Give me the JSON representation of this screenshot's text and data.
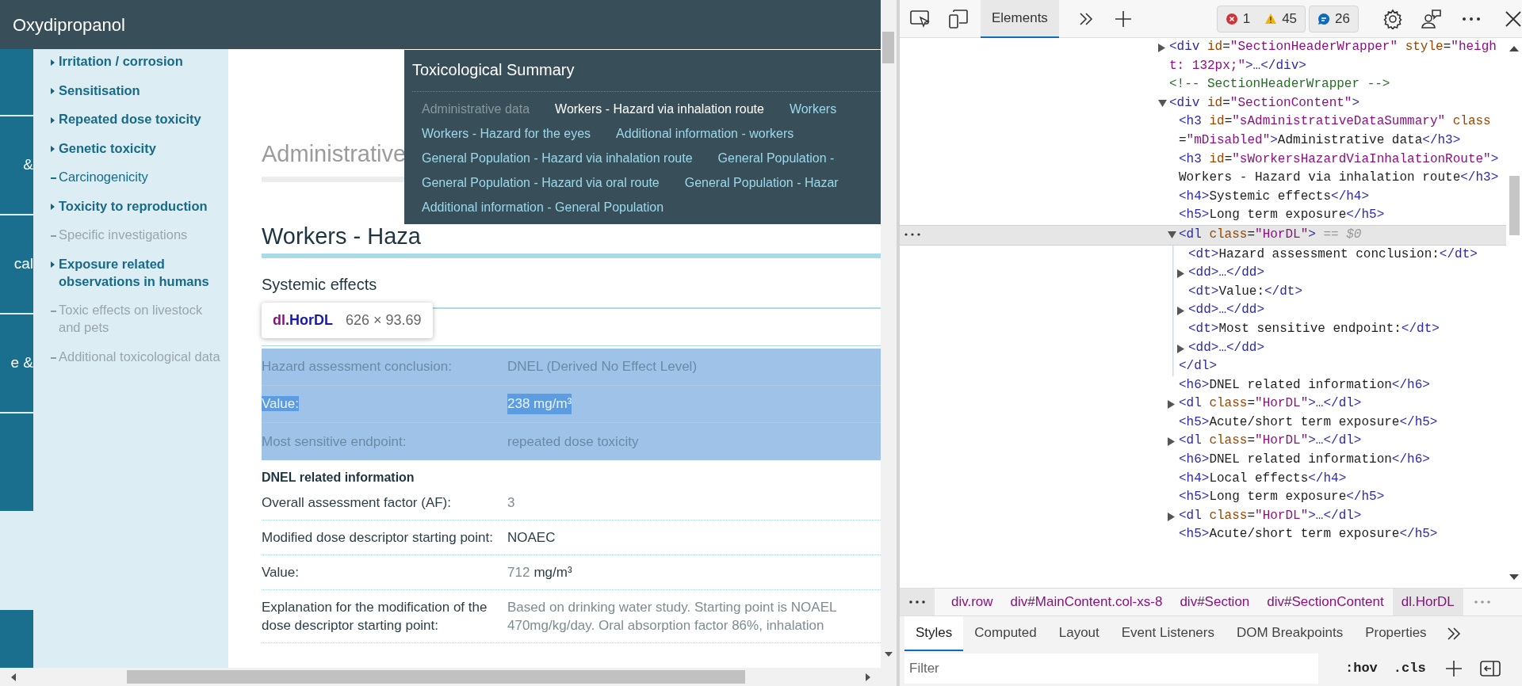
{
  "page": {
    "title": "Oxydipropanol",
    "strip": [
      {
        "kind": "blank"
      },
      {
        "kind": "text",
        "label": "&"
      },
      {
        "kind": "text",
        "label": "cal"
      },
      {
        "kind": "text",
        "label": "e &"
      },
      {
        "kind": "blank"
      },
      {
        "kind": "blank"
      }
    ],
    "nav": [
      {
        "label": "Irritation / corrosion",
        "kind": "section",
        "disabled": false
      },
      {
        "label": "Sensitisation",
        "kind": "section",
        "disabled": false
      },
      {
        "label": "Repeated dose toxicity",
        "kind": "section",
        "disabled": false
      },
      {
        "label": "Genetic toxicity",
        "kind": "section",
        "disabled": false
      },
      {
        "label": "Carcinogenicity",
        "kind": "leaf",
        "disabled": false
      },
      {
        "label": "Toxicity to reproduction",
        "kind": "section",
        "disabled": false
      },
      {
        "label": "Specific investigations",
        "kind": "leaf",
        "disabled": true
      },
      {
        "label": "Exposure related observations in humans",
        "kind": "section",
        "disabled": false
      },
      {
        "label": "Toxic effects on livestock and pets",
        "kind": "leaf",
        "disabled": true
      },
      {
        "label": "Additional toxicological data",
        "kind": "leaf",
        "disabled": true
      }
    ],
    "admin_heading": "Administrative",
    "section_heading": "Workers - Haza",
    "subheading": "Systemic effects",
    "inspected_list": {
      "highlighted": true,
      "rows": [
        {
          "label": "Hazard assessment conclusion:",
          "value": "DNEL (Derived No Effect Level)",
          "text_selected": false
        },
        {
          "label": "Value:",
          "value": "238 mg/m³",
          "text_selected": true
        },
        {
          "label": "Most sensitive endpoint:",
          "value": "repeated dose toxicity",
          "text_selected": false
        }
      ]
    },
    "dnel_heading": "DNEL related information",
    "dnel_rows": [
      {
        "kind": "number",
        "label": "Overall assessment factor (AF):",
        "value": "3"
      },
      {
        "kind": "text",
        "label": "Modified dose descriptor starting point:",
        "value": "NOAEC"
      },
      {
        "kind": "measure",
        "label": "Value:",
        "value": "712",
        "unit": "mg/m³"
      },
      {
        "kind": "lines",
        "label": "Explanation for the modification of the dose descriptor starting point:",
        "value_lines": [
          "Based on drinking water study. Starting point is NOAEL",
          "470mg/kg/day. Oral absorption factor 86%, inhalation"
        ]
      }
    ],
    "tooltip": {
      "tag": "dl",
      "class": ".HorDL",
      "size": "626 × 93.69"
    },
    "summary_popup": {
      "title": "Toxicological Summary",
      "rows": [
        [
          {
            "label": "Administrative data",
            "disabled": true,
            "selected": false
          },
          {
            "label": "Workers - Hazard via inhalation route",
            "disabled": false,
            "selected": true
          },
          {
            "label": "Workers",
            "disabled": false,
            "selected": false
          }
        ],
        [
          {
            "label": "Workers - Hazard for the eyes",
            "disabled": false,
            "selected": false
          },
          {
            "label": "Additional information - workers",
            "disabled": false,
            "selected": false
          }
        ],
        [
          {
            "label": "General Population - Hazard via inhalation route",
            "disabled": false,
            "selected": false
          },
          {
            "label": "General Population -",
            "disabled": false,
            "selected": false
          }
        ],
        [
          {
            "label": "General Population - Hazard via oral route",
            "disabled": false,
            "selected": false
          },
          {
            "label": "General Population - Hazar",
            "disabled": false,
            "selected": false
          }
        ],
        [
          {
            "label": "Additional information - General Population",
            "disabled": false,
            "selected": false
          }
        ]
      ]
    }
  },
  "devtools": {
    "tabs": [
      {
        "label": "Elements",
        "selected": true
      }
    ],
    "issues": {
      "errors": "1",
      "warnings": "45",
      "messages": "26"
    },
    "tree": [
      {
        "parts": [
          {
            "kind": "tag",
            "text": "<div"
          },
          {
            "kind": "attr",
            "text": " id"
          },
          {
            "kind": "plain",
            "text": "="
          },
          {
            "kind": "val",
            "text": "\"SectionHeaderWrapper\""
          },
          {
            "kind": "attr",
            "text": " style"
          },
          {
            "kind": "plain",
            "text": "="
          },
          {
            "kind": "val",
            "text": "\"height: 132px;\""
          },
          {
            "kind": "tag",
            "text": ">…</div>"
          }
        ],
        "expanded": false,
        "selected": false
      },
      {
        "parts": [
          {
            "kind": "comment",
            "text": "<!-- SectionHeaderWrapper -->"
          }
        ],
        "selected": false
      },
      {
        "parts": [
          {
            "kind": "tag",
            "text": "<div"
          },
          {
            "kind": "attr",
            "text": " id"
          },
          {
            "kind": "plain",
            "text": "="
          },
          {
            "kind": "val",
            "text": "\"SectionContent\""
          },
          {
            "kind": "tag",
            "text": ">"
          }
        ],
        "expanded": true,
        "selected": false,
        "children": [
          {
            "parts": [
              {
                "kind": "tag",
                "text": "<h3"
              },
              {
                "kind": "attr",
                "text": " id"
              },
              {
                "kind": "plain",
                "text": "="
              },
              {
                "kind": "val",
                "text": "\"sAdministrativeDataSummary\""
              },
              {
                "kind": "attr",
                "text": " class"
              },
              {
                "kind": "plain",
                "text": "="
              },
              {
                "kind": "val",
                "text": "\"mDisabled\""
              },
              {
                "kind": "tag",
                "text": ">"
              },
              {
                "kind": "plain",
                "text": "Administrative data"
              },
              {
                "kind": "tag",
                "text": "</h3>"
              }
            ],
            "selected": false
          },
          {
            "parts": [
              {
                "kind": "tag",
                "text": "<h3"
              },
              {
                "kind": "attr",
                "text": " id"
              },
              {
                "kind": "plain",
                "text": "="
              },
              {
                "kind": "val",
                "text": "\"sWorkersHazardViaInhalationRoute\""
              },
              {
                "kind": "tag",
                "text": ">"
              },
              {
                "kind": "plain",
                "text": "Workers - Hazard via inhalation route"
              },
              {
                "kind": "tag",
                "text": "</h3>"
              }
            ],
            "selected": false
          },
          {
            "parts": [
              {
                "kind": "tag",
                "text": "<h4>"
              },
              {
                "kind": "plain",
                "text": "Systemic effects"
              },
              {
                "kind": "tag",
                "text": "</h4>"
              }
            ],
            "selected": false
          },
          {
            "parts": [
              {
                "kind": "tag",
                "text": "<h5>"
              },
              {
                "kind": "plain",
                "text": "Long term exposure"
              },
              {
                "kind": "tag",
                "text": "</h5>"
              }
            ],
            "selected": false
          },
          {
            "parts": [
              {
                "kind": "tag",
                "text": "<dl"
              },
              {
                "kind": "attr",
                "text": " class"
              },
              {
                "kind": "plain",
                "text": "="
              },
              {
                "kind": "val",
                "text": "\"HorDL\""
              },
              {
                "kind": "tag",
                "text": ">"
              },
              {
                "kind": "dim",
                "text": " == $0"
              }
            ],
            "expanded": true,
            "selected": true,
            "close": [
              {
                "kind": "tag",
                "text": "</dl>"
              }
            ],
            "children": [
              {
                "parts": [
                  {
                    "kind": "tag",
                    "text": "<dt>"
                  },
                  {
                    "kind": "plain",
                    "text": "Hazard assessment conclusion:"
                  },
                  {
                    "kind": "tag",
                    "text": "</dt>"
                  }
                ],
                "selected": false
              },
              {
                "parts": [
                  {
                    "kind": "tag",
                    "text": "<dd>…</dd>"
                  }
                ],
                "expanded": false,
                "selected": false
              },
              {
                "parts": [
                  {
                    "kind": "tag",
                    "text": "<dt>"
                  },
                  {
                    "kind": "plain",
                    "text": "Value:"
                  },
                  {
                    "kind": "tag",
                    "text": "</dt>"
                  }
                ],
                "selected": false
              },
              {
                "parts": [
                  {
                    "kind": "tag",
                    "text": "<dd>…</dd>"
                  }
                ],
                "expanded": false,
                "selected": false
              },
              {
                "parts": [
                  {
                    "kind": "tag",
                    "text": "<dt>"
                  },
                  {
                    "kind": "plain",
                    "text": "Most sensitive endpoint:"
                  },
                  {
                    "kind": "tag",
                    "text": "</dt>"
                  }
                ],
                "selected": false
              },
              {
                "parts": [
                  {
                    "kind": "tag",
                    "text": "<dd>…</dd>"
                  }
                ],
                "expanded": false,
                "selected": false
              }
            ]
          },
          {
            "parts": [
              {
                "kind": "tag",
                "text": "<h6>"
              },
              {
                "kind": "plain",
                "text": "DNEL related information"
              },
              {
                "kind": "tag",
                "text": "</h6>"
              }
            ],
            "selected": false
          },
          {
            "parts": [
              {
                "kind": "tag",
                "text": "<dl"
              },
              {
                "kind": "attr",
                "text": " class"
              },
              {
                "kind": "plain",
                "text": "="
              },
              {
                "kind": "val",
                "text": "\"HorDL\""
              },
              {
                "kind": "tag",
                "text": ">…</dl>"
              }
            ],
            "expanded": false,
            "selected": false
          },
          {
            "parts": [
              {
                "kind": "tag",
                "text": "<h5>"
              },
              {
                "kind": "plain",
                "text": "Acute/short term exposure"
              },
              {
                "kind": "tag",
                "text": "</h5>"
              }
            ],
            "selected": false
          },
          {
            "parts": [
              {
                "kind": "tag",
                "text": "<dl"
              },
              {
                "kind": "attr",
                "text": " class"
              },
              {
                "kind": "plain",
                "text": "="
              },
              {
                "kind": "val",
                "text": "\"HorDL\""
              },
              {
                "kind": "tag",
                "text": ">…</dl>"
              }
            ],
            "expanded": false,
            "selected": false
          },
          {
            "parts": [
              {
                "kind": "tag",
                "text": "<h6>"
              },
              {
                "kind": "plain",
                "text": "DNEL related information"
              },
              {
                "kind": "tag",
                "text": "</h6>"
              }
            ],
            "selected": false
          },
          {
            "parts": [
              {
                "kind": "tag",
                "text": "<h4>"
              },
              {
                "kind": "plain",
                "text": "Local effects"
              },
              {
                "kind": "tag",
                "text": "</h4>"
              }
            ],
            "selected": false
          },
          {
            "parts": [
              {
                "kind": "tag",
                "text": "<h5>"
              },
              {
                "kind": "plain",
                "text": "Long term exposure"
              },
              {
                "kind": "tag",
                "text": "</h5>"
              }
            ],
            "selected": false
          },
          {
            "parts": [
              {
                "kind": "tag",
                "text": "<dl"
              },
              {
                "kind": "attr",
                "text": " class"
              },
              {
                "kind": "plain",
                "text": "="
              },
              {
                "kind": "val",
                "text": "\"HorDL\""
              },
              {
                "kind": "tag",
                "text": ">…</dl>"
              }
            ],
            "expanded": false,
            "selected": false
          },
          {
            "parts": [
              {
                "kind": "tag",
                "text": "<h5>"
              },
              {
                "kind": "plain",
                "text": "Acute/short term exposure"
              },
              {
                "kind": "tag",
                "text": "</h5>"
              }
            ],
            "selected": false
          }
        ]
      }
    ],
    "breadcrumbs": [
      {
        "label": "div.row",
        "selected": false
      },
      {
        "label": "div#MainContent.col-xs-8",
        "selected": false
      },
      {
        "label": "div#Section",
        "selected": false
      },
      {
        "label": "div#SectionContent",
        "selected": false
      },
      {
        "label": "dl.HorDL",
        "selected": true
      }
    ],
    "panel_tabs": [
      {
        "label": "Styles",
        "selected": true
      },
      {
        "label": "Computed",
        "selected": false
      },
      {
        "label": "Layout",
        "selected": false
      },
      {
        "label": "Event Listeners",
        "selected": false
      },
      {
        "label": "DOM Breakpoints",
        "selected": false
      },
      {
        "label": "Properties",
        "selected": false
      }
    ],
    "filter": {
      "placeholder": "Filter"
    },
    "filter_buttons": [
      ":hov",
      ".cls"
    ]
  }
}
